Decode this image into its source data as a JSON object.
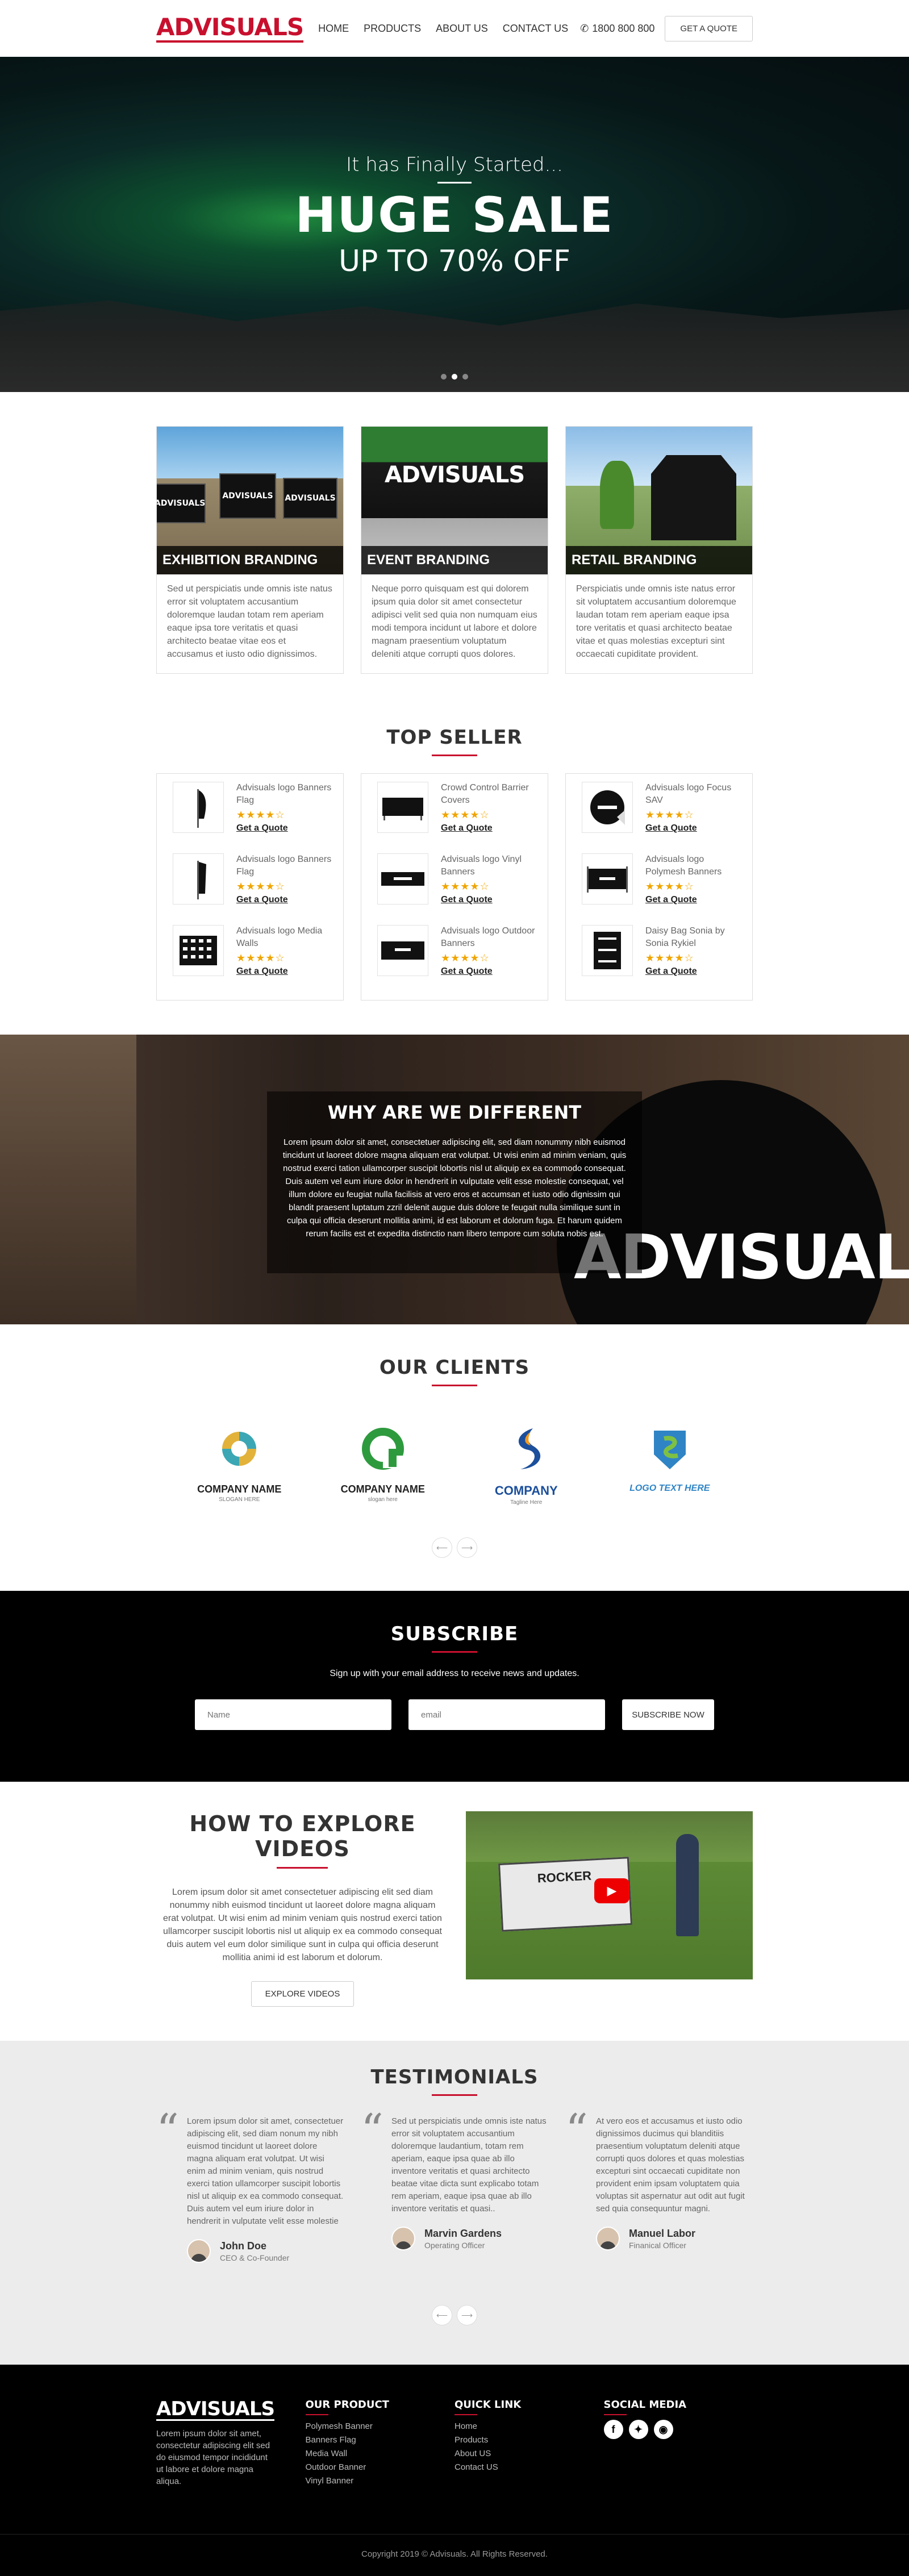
{
  "brand": {
    "logo": "ADVISUALS",
    "accent": "#c8102e"
  },
  "header": {
    "nav": [
      "HOME",
      "PRODUCTS",
      "ABOUT US",
      "CONTACT US"
    ],
    "phone": "1800 800 800",
    "quote_button": "GET A QUOTE"
  },
  "hero": {
    "small": "It has Finally Started...",
    "big": "HUGE SALE",
    "sub": "UP TO 70% OFF",
    "active_slide": 2,
    "slides": 3
  },
  "branding": [
    {
      "title": "EXHIBITION BRANDING",
      "text": "Sed ut perspiciatis unde omnis iste natus error sit voluptatem accusantium doloremque laudan totam rem aperiam eaque ipsa tore veritatis et quasi architecto beatae vitae eos et accusamus et iusto odio dignissimos."
    },
    {
      "title": "EVENT BRANDING",
      "text": "Neque porro quisquam est qui dolorem ipsum quia dolor sit amet consectetur adipisci velit sed quia non numquam eius modi tempora incidunt ut labore et dolore magnam praesentium voluptatum deleniti atque corrupti quos dolores."
    },
    {
      "title": "RETAIL BRANDING",
      "text": "Perspiciatis unde omnis iste natus error sit voluptatem accusantium doloremque laudan totam rem aperiam eaque ipsa tore veritatis et quasi architecto beatae vitae et quas molestias excepturi sint occaecati cupiditate provident."
    }
  ],
  "banner_text": "ADVISUALS",
  "top_seller": {
    "title": "TOP SELLER",
    "columns": [
      [
        {
          "name": "Advisuals logo Banners Flag",
          "rating": 4,
          "link": "Get a Quote"
        },
        {
          "name": "Advisuals logo Banners Flag",
          "rating": 4,
          "link": "Get a Quote"
        },
        {
          "name": "Advisuals logo Media Walls",
          "rating": 4,
          "link": "Get a Quote"
        }
      ],
      [
        {
          "name": "Crowd Control Barrier Covers",
          "rating": 4,
          "link": "Get a Quote"
        },
        {
          "name": "Advisuals logo Vinyl Banners",
          "rating": 4,
          "link": "Get a Quote"
        },
        {
          "name": "Advisuals logo Outdoor Banners",
          "rating": 4,
          "link": "Get a Quote"
        }
      ],
      [
        {
          "name": "Advisuals logo Focus SAV",
          "rating": 4,
          "link": "Get a Quote"
        },
        {
          "name": "Advisuals logo Polymesh Banners",
          "rating": 4,
          "link": "Get a Quote"
        },
        {
          "name": "Daisy Bag Sonia by Sonia Rykiel",
          "rating": 4,
          "link": "Get a Quote"
        }
      ]
    ]
  },
  "why": {
    "title": "WHY ARE WE DIFFERENT",
    "text": "Lorem ipsum dolor sit amet, consectetuer adipiscing elit, sed diam nonummy nibh euismod tincidunt ut laoreet dolore magna aliquam erat volutpat. Ut wisi enim ad minim veniam, quis nostrud exerci tation ullamcorper suscipit lobortis nisl ut aliquip ex ea commodo consequat. Duis autem vel eum iriure dolor in hendrerit in vulputate velit esse molestie consequat, vel illum dolore eu feugiat nulla facilisis at vero eros et accumsan et iusto odio dignissim qui blandit praesent luptatum zzril delenit augue duis dolore te feugait nulla similique sunt in culpa qui officia deserunt mollitia animi, id est laborum et dolorum fuga. Et harum quidem rerum facilis est et expedita distinctio nam libero tempore cum soluta nobis est.",
    "brand": "ADVISUALS"
  },
  "clients": {
    "title": "OUR CLIENTS",
    "items": [
      {
        "name": "COMPANY NAME",
        "sub": "SLOGAN HERE",
        "color": "#3ba7b4"
      },
      {
        "name": "COMPANY NAME",
        "sub": "slogan here",
        "color": "#2e9a3e"
      },
      {
        "name": "COMPANY",
        "sub": "Tagline Here",
        "color": "#1c4f9c"
      },
      {
        "name": "LOGO TEXT HERE",
        "sub": "",
        "color": "#2f84c5"
      }
    ]
  },
  "subscribe": {
    "title": "SUBSCRIBE",
    "text": "Sign up with your email address to receive news and updates.",
    "name_placeholder": "Name",
    "email_placeholder": "email",
    "button": "SUBSCRIBE NOW"
  },
  "videos": {
    "title": "HOW TO EXPLORE VIDEOS",
    "text": "Lorem ipsum dolor sit amet consectetuer adipiscing elit sed diam nonummy nibh euismod tincidunt ut laoreet dolore magna aliquam erat volutpat. Ut wisi enim ad minim veniam quis nostrud exerci tation ullamcorper suscipit lobortis nisl ut aliquip ex ea commodo consequat duis autem vel eum dolor similique sunt in culpa qui officia deserunt mollitia animi id est laborum et dolorum.",
    "button": "EXPLORE VIDEOS",
    "sign_text": "ROCKER"
  },
  "testimonials": {
    "title": "TESTIMONIALS",
    "items": [
      {
        "text": "Lorem ipsum dolor sit amet, consectetuer adipiscing elit, sed diam nonum my nibh euismod tincidunt ut laoreet dolore magna aliquam erat volutpat. Ut wisi enim ad minim veniam, quis nostrud exerci tation ullamcorper suscipit lobortis nisl ut aliquip ex ea commodo consequat. Duis autem vel eum iriure dolor in hendrerit in vulputate velit esse molestie consequat, vel illum dolore eu feugiat nulla facilisis at vero eros et accumsan et iusto odio dignissim qui blandit praesent luptatum zzril delenit augue duis dolore te feugait nulla facilisi.",
        "short": "Lorem ipsum dolor sit amet, consectetuer adipiscing elit, sed diam nonum my nibh euismod tincidunt ut laoreet dolore magna aliquam erat volutpat. Ut wisi enim ad minim veniam, quis nostrud exerci tation ullamcorper suscipit lobortis nisl ut aliquip ex ea commodo consequat. Duis autem vel eum iriure dolor in hendrerit in vulputate velit esse molestie consequat, vel illum dolore eu feugiat nulla facilisis at vero eros et accumsan et iusto odio dignissim qui blandit praesent luptatum zzril delenit augue duis dolore te feugait nulla facilisi. omnis iste natus error sit voluptatem accusa..",
        "name": "John Doe",
        "role": "CEO & Co-Founder"
      },
      {
        "text": "Sed ut perspiciatis unde omnis iste natus error sit voluptatem accusantium doloremque laudantium, totam rem aperiam, eaque ipsa quae ab illo inventore veritatis et quasi architecto beatae vitae dicta sunt explicabo totam rem aperiam, eaque ipsa quae ab illo inventore veritatis et quasi..",
        "short": "Sed ut perspiciatis unde omnis iste natus error sit voluptatem accusantium doloremque laudantium, totam rem aperiam, eaque ipsa quae ab illo inventore veritatis et quasi architecto beatae vitae dicta sunt explicabo totam rem aperiam, eaque ipsa quae ab illo inventore veritatis et quasi..",
        "name": "Marvin Gardens",
        "role": "Operating Officer"
      },
      {
        "text": "At vero eos et accusamus et iusto odio dignissimos ducimus qui blanditiis praesentium voluptatum deleniti atque corrupti quos dolores et quas molestias excepturi sint occaecati cupiditate non provident enim ipsam voluptatem quia voluptas sit aspernatur aut odit aut fugit sed quia consequuntur magni.",
        "short": "At vero eos et accusamus et iusto odio dignissimos ducimus qui blanditiis praesentium voluptatum deleniti atque corrupti quos dolores et quas molestias excepturi sint occaecati cupiditate non provident enim ipsam voluptatem quia voluptas sit aspernatur aut odit aut fugit sed quia consequuntur magni.",
        "name": "Manuel Labor",
        "role": "Finanical Officer"
      }
    ]
  },
  "footer": {
    "logo": "ADVISUALS",
    "desc": "Lorem ipsum dolor sit amet, consectetur adipiscing elit sed do eiusmod tempor incididunt ut labore et dolore magna aliqua.",
    "product_title": "OUR PRODUCT",
    "products": [
      "Polymesh Banner",
      "Banners Flag",
      "Media Wall",
      "Outdoor Banner",
      "Vinyl Banner"
    ],
    "quick_title": "QUICK LINK",
    "quick": [
      "Home",
      "Products",
      "About US",
      "Contact US"
    ],
    "social_title": "SOCIAL MEDIA",
    "socials": [
      "facebook-icon",
      "twitter-icon",
      "instagram-icon"
    ],
    "copyright": "Copyright 2019 © Advisuals. All Rights Reserved."
  }
}
